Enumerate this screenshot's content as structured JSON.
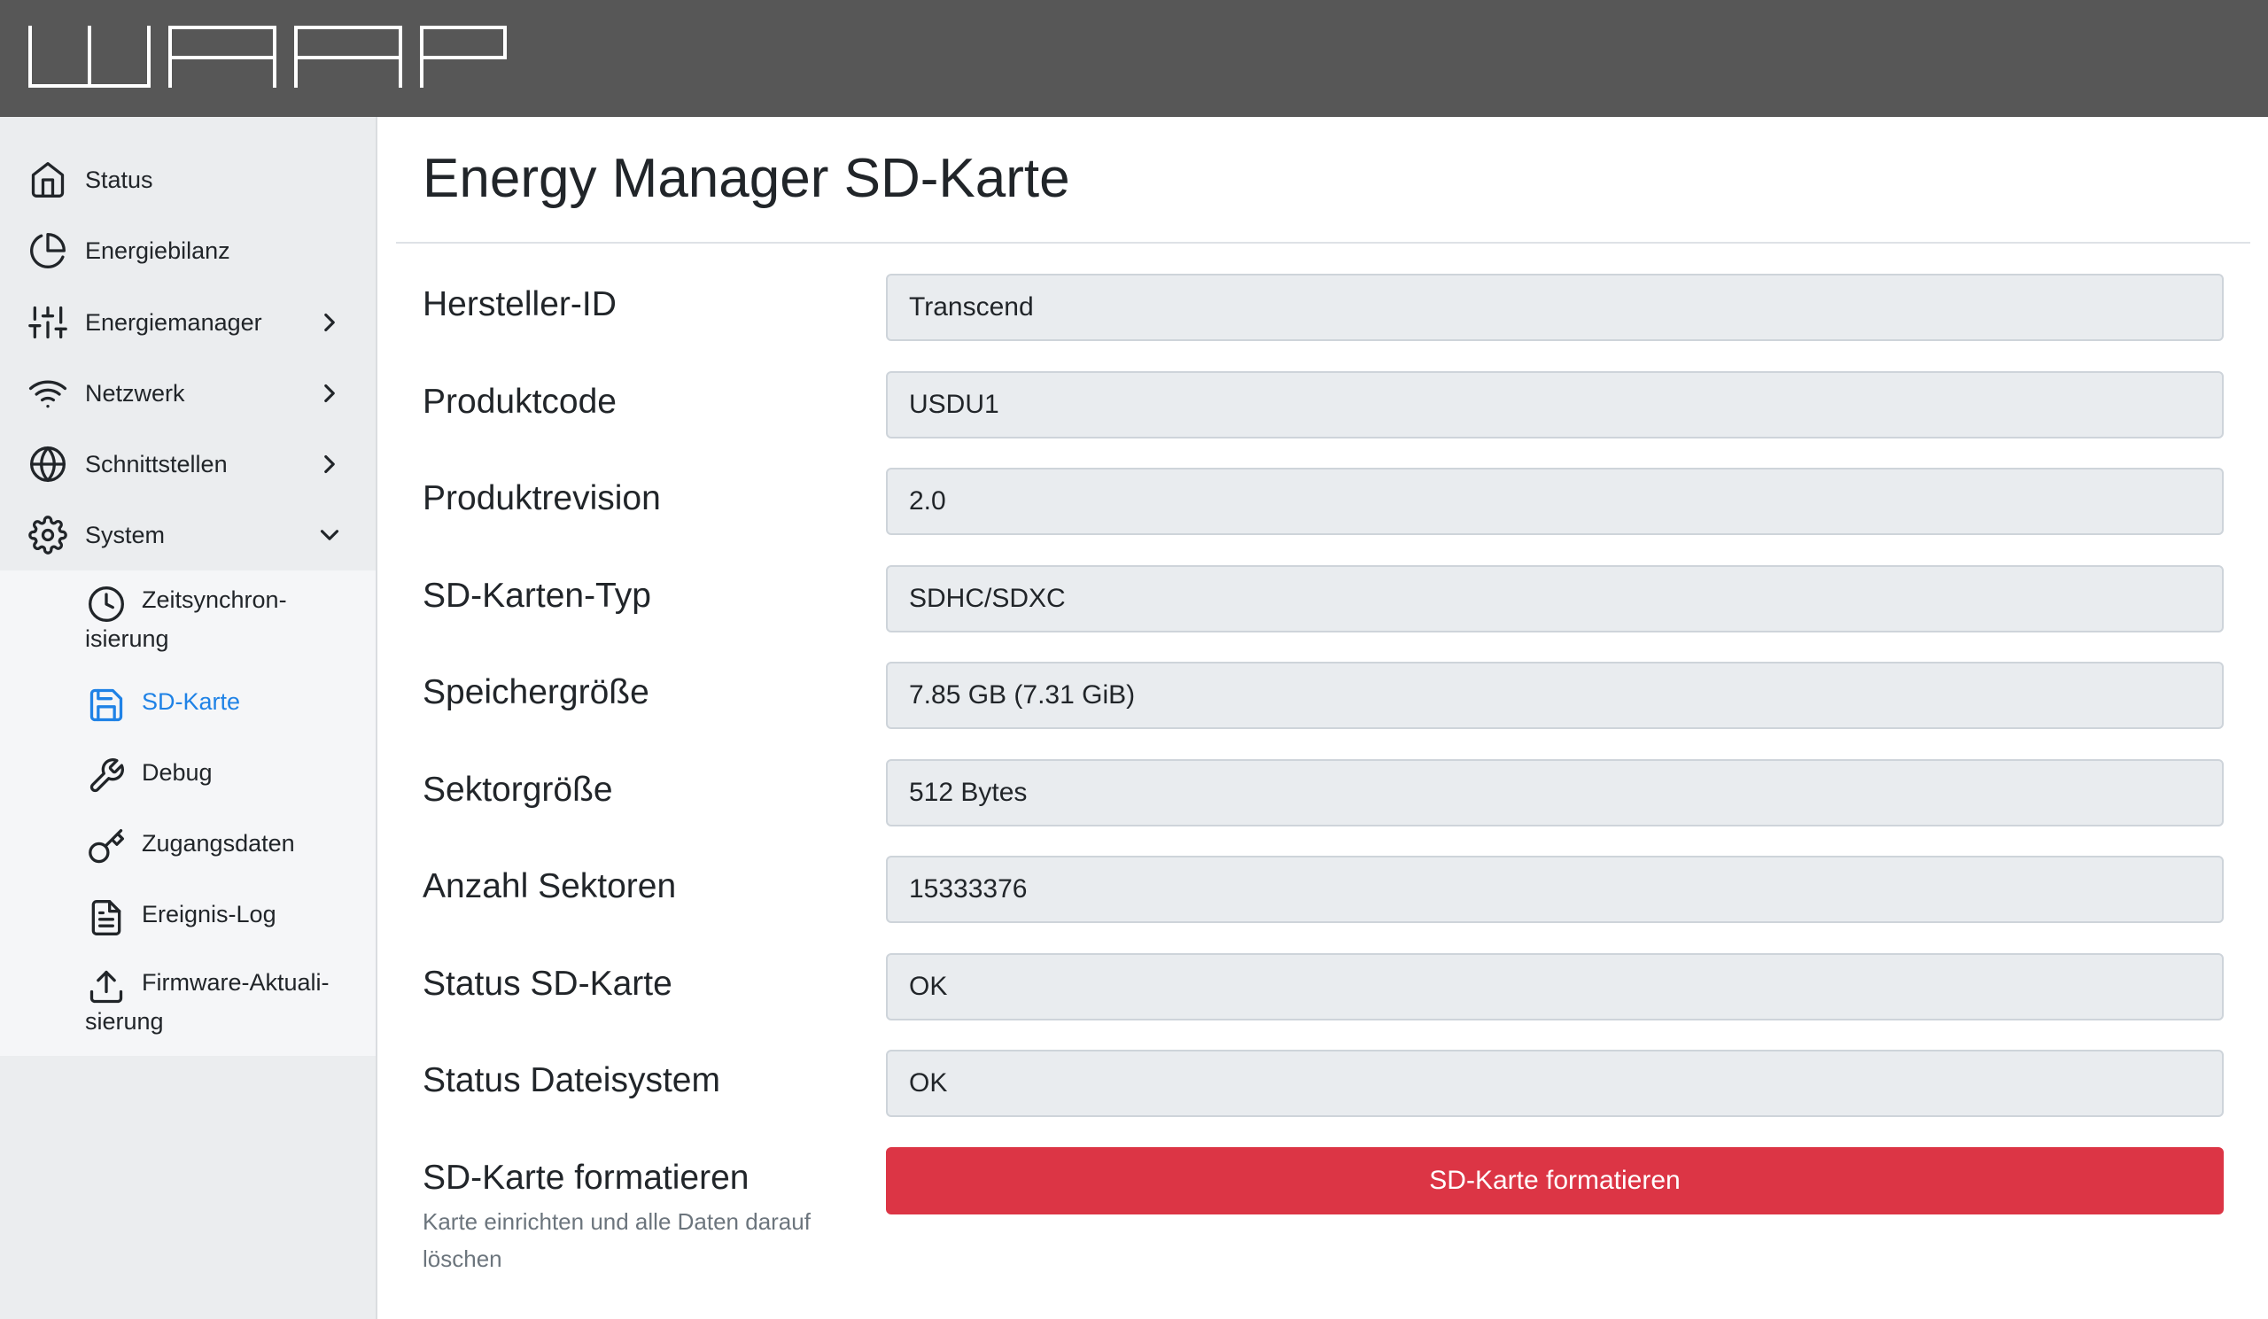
{
  "app": {
    "logo_text": "WARP"
  },
  "sidebar": {
    "items": [
      {
        "label": "Status",
        "icon": "home-icon"
      },
      {
        "label": "Energiebilanz",
        "icon": "pie-chart-icon"
      },
      {
        "label": "Energiemanager",
        "icon": "sliders-icon",
        "chevron": "right"
      },
      {
        "label": "Netzwerk",
        "icon": "wifi-icon",
        "chevron": "right"
      },
      {
        "label": "Schnittstellen",
        "icon": "globe-icon",
        "chevron": "right"
      },
      {
        "label": "System",
        "icon": "gear-icon",
        "chevron": "down",
        "expanded": true
      }
    ],
    "system_items": [
      {
        "label_line1": "Zeitsynchron-",
        "label_line2": "isierung",
        "icon": "clock-icon"
      },
      {
        "label_line1": "SD-Karte",
        "icon": "save-icon",
        "active": true
      },
      {
        "label_line1": "Debug",
        "icon": "wrench-icon"
      },
      {
        "label_line1": "Zugangsdaten",
        "icon": "key-icon"
      },
      {
        "label_line1": "Ereignis-Log",
        "icon": "file-text-icon"
      },
      {
        "label_line1": "Firmware-Aktuali-",
        "label_line2": "sierung",
        "icon": "upload-icon"
      }
    ],
    "active_color": "#1f82e6"
  },
  "main": {
    "title": "Energy Manager SD-Karte",
    "rows": [
      {
        "label": "Hersteller-ID",
        "value": "Transcend"
      },
      {
        "label": "Produktcode",
        "value": "USDU1"
      },
      {
        "label": "Produktrevision",
        "value": "2.0"
      },
      {
        "label": "SD-Karten-Typ",
        "value": "SDHC/SDXC"
      },
      {
        "label": "Speichergröße",
        "value": "7.85 GB (7.31 GiB)"
      },
      {
        "label": "Sektorgröße",
        "value": "512 Bytes"
      },
      {
        "label": "Anzahl Sektoren",
        "value": "15333376"
      },
      {
        "label": "Status SD-Karte",
        "value": "OK"
      },
      {
        "label": "Status Dateisystem",
        "value": "OK"
      }
    ],
    "format": {
      "label": "SD-Karte formatieren",
      "description": "Karte einrichten und alle Daten darauf löschen",
      "button_label": "SD-Karte formatieren",
      "button_color": "#dc3545"
    }
  },
  "colors": {
    "topbar": "#575757",
    "sidebar": "#ebedef",
    "field_bg": "#e9ecef"
  }
}
